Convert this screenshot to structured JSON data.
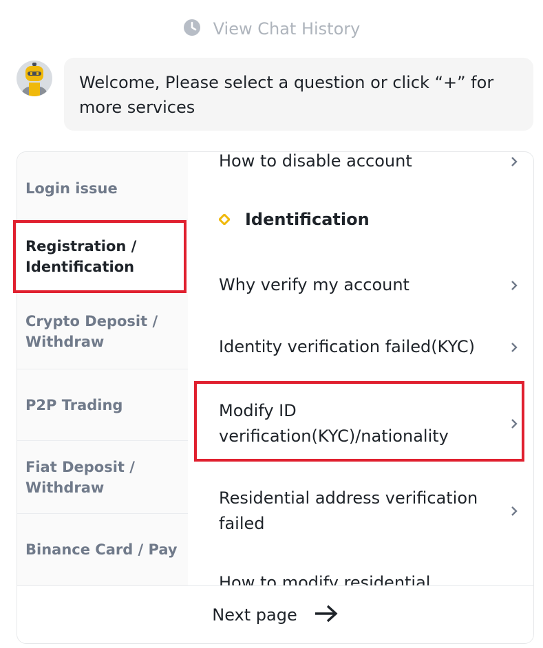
{
  "history": {
    "label": "View Chat History",
    "icon": "clock-icon"
  },
  "bot": {
    "avatar_icon": "robot-avatar",
    "message": "Welcome, Please select a question or click “+” for more services"
  },
  "sidebar": {
    "items": [
      {
        "label": "Login issue"
      },
      {
        "label": "Registration / Identification",
        "active": true
      },
      {
        "label": "Crypto Deposit / Withdraw"
      },
      {
        "label": "P2P Trading"
      },
      {
        "label": "Fiat Deposit / Withdraw"
      },
      {
        "label": "Binance Card / Pay"
      }
    ]
  },
  "content": {
    "section_title": "Identification",
    "questions": [
      {
        "label": "How to disable account"
      },
      {
        "label": "Why verify my account"
      },
      {
        "label": "Identity verification failed(KYC)"
      },
      {
        "label": "Modify ID verification(KYC)/nationality"
      },
      {
        "label": "Residential address verification failed"
      },
      {
        "label": "How to modify residential"
      }
    ]
  },
  "footer": {
    "next_label": "Next page",
    "icon": "arrow-right-icon"
  },
  "colors": {
    "accent": "#f0b90b",
    "highlight": "#e0202f",
    "muted_text": "#707a8a",
    "history_text": "#aeb4bc"
  }
}
